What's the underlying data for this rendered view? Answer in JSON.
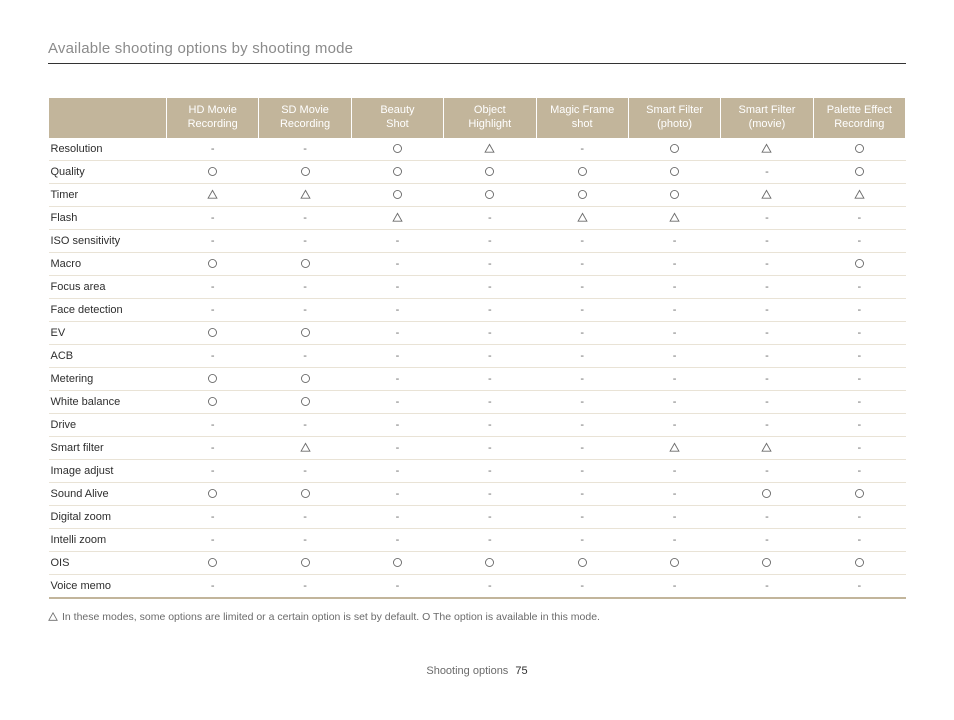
{
  "page_title": "Available shooting options by shooting mode",
  "columns": [
    "HD Movie Recording",
    "SD Movie Recording",
    "Beauty Shot",
    "Object Highlight",
    "Magic Frame shot",
    "Smart Filter (photo)",
    "Smart Filter (movie)",
    "Palette Effect Recording"
  ],
  "rows": [
    {
      "label": "Resolution",
      "cells": [
        "-",
        "-",
        "O",
        "T",
        "-",
        "O",
        "T",
        "O"
      ]
    },
    {
      "label": "Quality",
      "cells": [
        "O",
        "O",
        "O",
        "O",
        "O",
        "O",
        "-",
        "O"
      ]
    },
    {
      "label": "Timer",
      "cells": [
        "T",
        "T",
        "O",
        "O",
        "O",
        "O",
        "T",
        "T"
      ]
    },
    {
      "label": "Flash",
      "cells": [
        "-",
        "-",
        "T",
        "-",
        "T",
        "T",
        "-",
        "-"
      ]
    },
    {
      "label": "ISO sensitivity",
      "cells": [
        "-",
        "-",
        "-",
        "-",
        "-",
        "-",
        "-",
        "-"
      ]
    },
    {
      "label": "Macro",
      "cells": [
        "O",
        "O",
        "-",
        "-",
        "-",
        "-",
        "-",
        "O"
      ]
    },
    {
      "label": "Focus area",
      "cells": [
        "-",
        "-",
        "-",
        "-",
        "-",
        "-",
        "-",
        "-"
      ]
    },
    {
      "label": "Face detection",
      "cells": [
        "-",
        "-",
        "-",
        "-",
        "-",
        "-",
        "-",
        "-"
      ]
    },
    {
      "label": "EV",
      "cells": [
        "O",
        "O",
        "-",
        "-",
        "-",
        "-",
        "-",
        "-"
      ]
    },
    {
      "label": "ACB",
      "cells": [
        "-",
        "-",
        "-",
        "-",
        "-",
        "-",
        "-",
        "-"
      ]
    },
    {
      "label": "Metering",
      "cells": [
        "O",
        "O",
        "-",
        "-",
        "-",
        "-",
        "-",
        "-"
      ]
    },
    {
      "label": "White balance",
      "cells": [
        "O",
        "O",
        "-",
        "-",
        "-",
        "-",
        "-",
        "-"
      ]
    },
    {
      "label": "Drive",
      "cells": [
        "-",
        "-",
        "-",
        "-",
        "-",
        "-",
        "-",
        "-"
      ]
    },
    {
      "label": "Smart filter",
      "cells": [
        "-",
        "T",
        "-",
        "-",
        "-",
        "T",
        "T",
        "-"
      ]
    },
    {
      "label": "Image adjust",
      "cells": [
        "-",
        "-",
        "-",
        "-",
        "-",
        "-",
        "-",
        "-"
      ]
    },
    {
      "label": "Sound Alive",
      "cells": [
        "O",
        "O",
        "-",
        "-",
        "-",
        "-",
        "O",
        "O"
      ]
    },
    {
      "label": "Digital zoom",
      "cells": [
        "-",
        "-",
        "-",
        "-",
        "-",
        "-",
        "-",
        "-"
      ]
    },
    {
      "label": "Intelli zoom",
      "cells": [
        "-",
        "-",
        "-",
        "-",
        "-",
        "-",
        "-",
        "-"
      ]
    },
    {
      "label": "OIS",
      "cells": [
        "O",
        "O",
        "O",
        "O",
        "O",
        "O",
        "O",
        "O"
      ]
    },
    {
      "label": "Voice memo",
      "cells": [
        "-",
        "-",
        "-",
        "-",
        "-",
        "-",
        "-",
        "-"
      ]
    }
  ],
  "legend": {
    "triangle_note": "In these modes, some options are limited or a certain option is set by default.",
    "circle_note": "O The option is available in this mode."
  },
  "footer": {
    "section": "Shooting options",
    "page_number": "75"
  },
  "chart_data": {
    "type": "table",
    "title": "Available shooting options by shooting mode",
    "legend_symbols": {
      "O": "available",
      "T": "limited or default",
      "-": "not available"
    },
    "row_labels": [
      "Resolution",
      "Quality",
      "Timer",
      "Flash",
      "ISO sensitivity",
      "Macro",
      "Focus area",
      "Face detection",
      "EV",
      "ACB",
      "Metering",
      "White balance",
      "Drive",
      "Smart filter",
      "Image adjust",
      "Sound Alive",
      "Digital zoom",
      "Intelli zoom",
      "OIS",
      "Voice memo"
    ],
    "column_labels": [
      "HD Movie Recording",
      "SD Movie Recording",
      "Beauty Shot",
      "Object Highlight",
      "Magic Frame shot",
      "Smart Filter (photo)",
      "Smart Filter (movie)",
      "Palette Effect Recording"
    ],
    "matrix": [
      [
        "-",
        "-",
        "O",
        "T",
        "-",
        "O",
        "T",
        "O"
      ],
      [
        "O",
        "O",
        "O",
        "O",
        "O",
        "O",
        "-",
        "O"
      ],
      [
        "T",
        "T",
        "O",
        "O",
        "O",
        "O",
        "T",
        "T"
      ],
      [
        "-",
        "-",
        "T",
        "-",
        "T",
        "T",
        "-",
        "-"
      ],
      [
        "-",
        "-",
        "-",
        "-",
        "-",
        "-",
        "-",
        "-"
      ],
      [
        "O",
        "O",
        "-",
        "-",
        "-",
        "-",
        "-",
        "O"
      ],
      [
        "-",
        "-",
        "-",
        "-",
        "-",
        "-",
        "-",
        "-"
      ],
      [
        "-",
        "-",
        "-",
        "-",
        "-",
        "-",
        "-",
        "-"
      ],
      [
        "O",
        "O",
        "-",
        "-",
        "-",
        "-",
        "-",
        "-"
      ],
      [
        "-",
        "-",
        "-",
        "-",
        "-",
        "-",
        "-",
        "-"
      ],
      [
        "O",
        "O",
        "-",
        "-",
        "-",
        "-",
        "-",
        "-"
      ],
      [
        "O",
        "O",
        "-",
        "-",
        "-",
        "-",
        "-",
        "-"
      ],
      [
        "-",
        "-",
        "-",
        "-",
        "-",
        "-",
        "-",
        "-"
      ],
      [
        "-",
        "T",
        "-",
        "-",
        "-",
        "T",
        "T",
        "-"
      ],
      [
        "-",
        "-",
        "-",
        "-",
        "-",
        "-",
        "-",
        "-"
      ],
      [
        "O",
        "O",
        "-",
        "-",
        "-",
        "-",
        "O",
        "O"
      ],
      [
        "-",
        "-",
        "-",
        "-",
        "-",
        "-",
        "-",
        "-"
      ],
      [
        "-",
        "-",
        "-",
        "-",
        "-",
        "-",
        "-",
        "-"
      ],
      [
        "O",
        "O",
        "O",
        "O",
        "O",
        "O",
        "O",
        "O"
      ],
      [
        "-",
        "-",
        "-",
        "-",
        "-",
        "-",
        "-",
        "-"
      ]
    ]
  }
}
